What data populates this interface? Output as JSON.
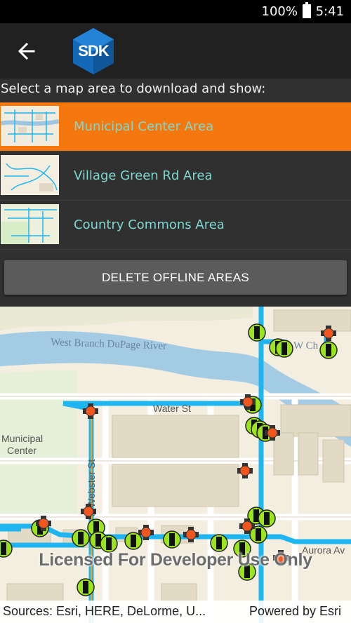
{
  "status_bar": {
    "battery": "100%",
    "time": "5:41"
  },
  "app_bar": {
    "logo_text": "SDK"
  },
  "instructions": "Select a map area to download and show:",
  "areas": [
    {
      "label": "Municipal Center Area",
      "selected": true
    },
    {
      "label": "Village Green Rd Area",
      "selected": false
    },
    {
      "label": "Country Commons Area",
      "selected": false
    }
  ],
  "delete_button": "DELETE OFFLINE AREAS",
  "map": {
    "labels": {
      "river": "West Branch DuPage River",
      "river_right": "W Ch",
      "water_st": "Water St",
      "webster_st": "S Webster St",
      "municipal": "Municipal",
      "center": "Center",
      "aurora": "Aurora Av"
    },
    "watermark": "Licensed For Developer Use Only",
    "attribution_sources": "Sources: Esri, HERE, DeLorme, U...",
    "attribution_powered": "Powered by Esri"
  },
  "colors": {
    "accent": "#f5780f",
    "area_label": "#7ed7d0",
    "pipe": "#1fb5f0",
    "node_green": "#9be51a",
    "node_orange": "#f0561e"
  }
}
